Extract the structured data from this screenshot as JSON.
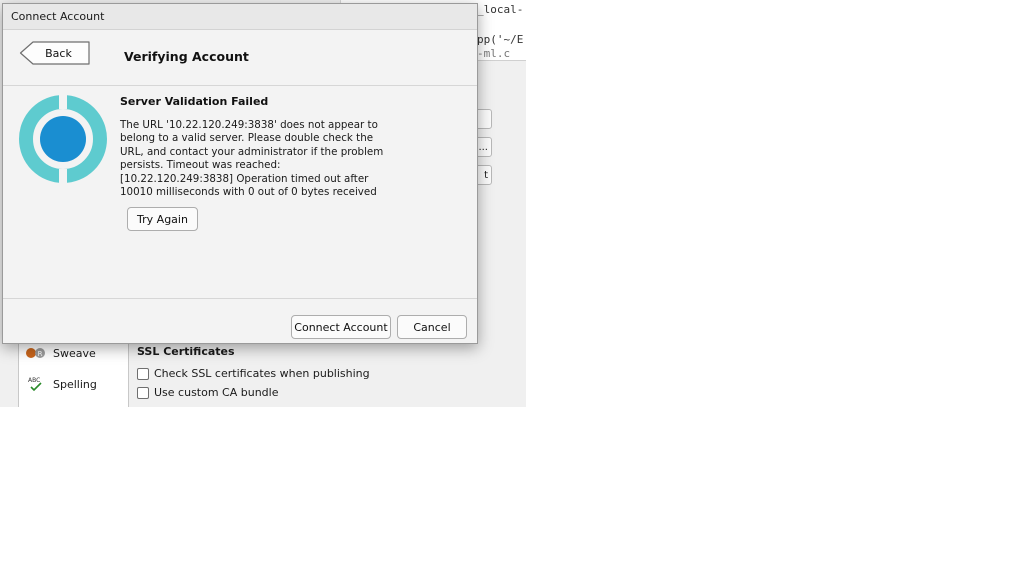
{
  "background": {
    "editor_lines": [
      "_local-",
      "pp('~/E",
      "-ml.c"
    ],
    "right_buttons": [
      "",
      "...",
      "t"
    ],
    "sidebar": {
      "items": [
        {
          "label": "Sweave",
          "icon": "sweave-icon"
        },
        {
          "label": "Spelling",
          "icon": "spelling-icon"
        }
      ]
    },
    "ssl": {
      "heading": "SSL Certificates",
      "options": [
        {
          "label": "Check SSL certificates when publishing",
          "checked": false
        },
        {
          "label": "Use custom CA bundle",
          "checked": false
        }
      ]
    }
  },
  "dialog": {
    "title": "Connect Account",
    "back_label": "Back",
    "heading": "Verifying Account",
    "error_title": "Server Validation Failed",
    "error_message": "The URL '10.22.120.249:3838' does not appear to belong to a valid server. Please double check the URL, and contact your administrator if the problem persists. Timeout was reached: [10.22.120.249:3838] Operation timed out after 10010 milliseconds with 0 out of 0 bytes received",
    "try_again_label": "Try Again",
    "connect_label": "Connect Account",
    "cancel_label": "Cancel",
    "logo_icon": "rstudio-connect-logo-icon"
  },
  "colors": {
    "logo_ring": "#5ecbcf",
    "logo_core": "#1a8ed1",
    "dialog_bg": "#f3f3f3"
  }
}
